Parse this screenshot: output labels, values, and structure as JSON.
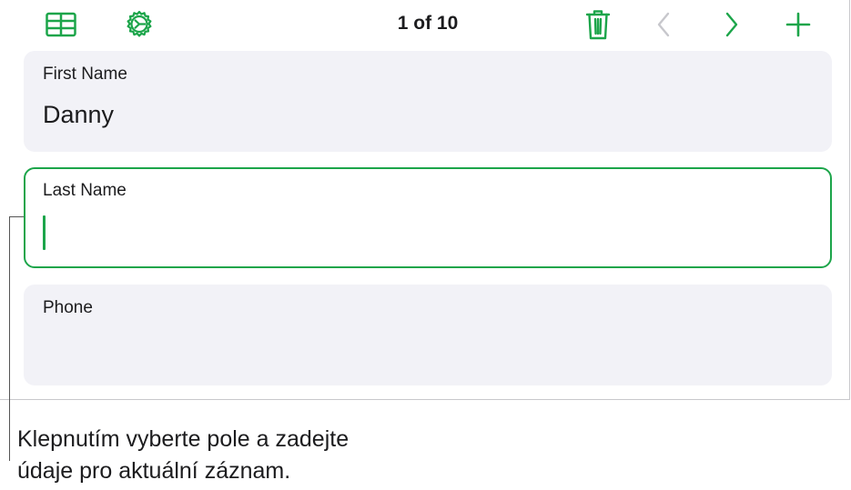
{
  "colors": {
    "accent": "#1ca54a",
    "disabled": "#c7c7cc",
    "card_background": "#f2f2f7",
    "text": "#1c1c1e"
  },
  "toolbar": {
    "left_icons": [
      "table-grid-icon",
      "settings-gear-icon"
    ],
    "record_position": "1 of 10",
    "right_icons": [
      "trash-icon",
      "chevron-left-icon",
      "chevron-right-icon",
      "plus-icon"
    ],
    "previous_enabled": false
  },
  "fields": [
    {
      "label": "First Name",
      "value": "Danny",
      "focused": false
    },
    {
      "label": "Last Name",
      "value": "",
      "focused": true
    },
    {
      "label": "Phone",
      "value": "",
      "focused": false
    }
  ],
  "callout": {
    "line1": "Klepnutím vyberte pole a zadejte",
    "line2": "údaje pro aktuální záznam."
  }
}
